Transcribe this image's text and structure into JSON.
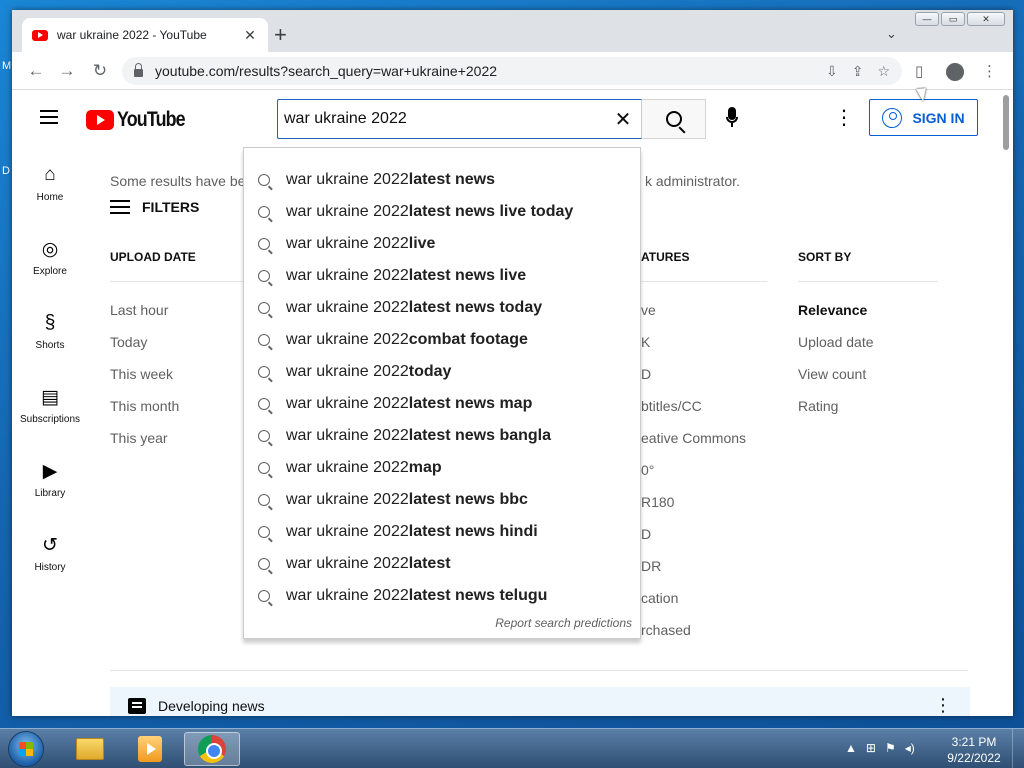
{
  "browser": {
    "tab_title": "war ukraine 2022 - YouTube",
    "tab_close": "✕",
    "new_tab": "+",
    "tab_dropdown": "⌄",
    "url": "youtube.com/results?search_query=war+ukraine+2022",
    "window_controls": {
      "minimize": "—",
      "maximize": "▭",
      "close": "✕"
    }
  },
  "youtube": {
    "logo_text": "YouTube",
    "search_value": "war ukraine 2022",
    "clear_label": "✕",
    "more_label": "⋮",
    "signin_label": "SIGN IN",
    "guide": [
      {
        "label": "Home",
        "icon": "home-icon",
        "glyph": "⌂"
      },
      {
        "label": "Explore",
        "icon": "explore-icon",
        "glyph": "◎"
      },
      {
        "label": "Shorts",
        "icon": "shorts-icon",
        "glyph": "§"
      },
      {
        "label": "Subscriptions",
        "icon": "subscriptions-icon",
        "glyph": "▤"
      },
      {
        "label": "Library",
        "icon": "library-icon",
        "glyph": "▶"
      },
      {
        "label": "History",
        "icon": "history-icon",
        "glyph": "↺"
      }
    ],
    "notice_left": "Some results have be",
    "notice_right": "k administrator.",
    "filters_label": "FILTERS",
    "upload_date": {
      "header": "UPLOAD DATE",
      "items": [
        "Last hour",
        "Today",
        "This week",
        "This month",
        "This year"
      ]
    },
    "features": {
      "header": "ATURES",
      "items": [
        "ve",
        "K",
        "D",
        "btitles/CC",
        "eative Commons",
        "0°",
        "R180",
        "D",
        "DR",
        "cation",
        "rchased"
      ]
    },
    "sort_by": {
      "header": "SORT BY",
      "items": [
        "Relevance",
        "Upload date",
        "View count",
        "Rating"
      ]
    },
    "developing_news": "Developing news",
    "developing_more": "⋮"
  },
  "suggestions": {
    "prefix": "war ukraine 2022",
    "items": [
      " latest news",
      " latest news live today",
      " live",
      " latest news live",
      " latest news today",
      " combat footage",
      " today",
      " latest news map",
      " latest news bangla",
      " map",
      " latest news bbc",
      " latest news hindi",
      " latest",
      " latest news telugu"
    ],
    "report": "Report search predictions"
  },
  "taskbar": {
    "time": "3:21 PM",
    "date": "9/22/2022",
    "tray_up": "▲"
  },
  "desktop": {
    "label1": "M",
    "label2": "D"
  },
  "colors": {
    "youtube_red": "#ff0000",
    "link_blue": "#065fd4",
    "search_focus": "#1c62b9"
  }
}
